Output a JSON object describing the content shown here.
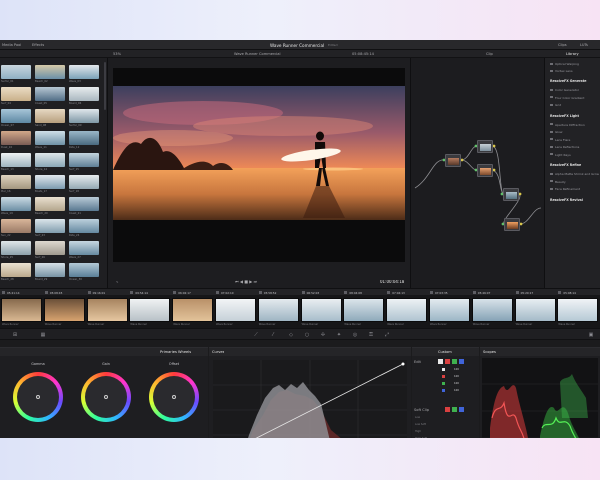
{
  "app": {
    "project_title": "Wave Runner Commercial",
    "project_status": "Edited",
    "timeline_name": "Wave Runner Commercial",
    "zoom": "53%"
  },
  "topbar": {
    "media_pool": "Media Pool",
    "effects": "Effects",
    "clips": "Clips",
    "library": "Library",
    "lut": "LUTs"
  },
  "viewer": {
    "timecode_top": "05:08:45:14",
    "clip_menu": "Clip",
    "timecode": "01:00:04:18",
    "sub_label": "Wave Runner Commercial"
  },
  "pool_thumbs": [
    {
      "label": "Surfer_01",
      "colors": [
        "#8fb0c4",
        "#c9d6de"
      ]
    },
    {
      "label": "Beach_02",
      "colors": [
        "#6a8fa8",
        "#d5c9a8"
      ]
    },
    {
      "label": "Wave_03",
      "colors": [
        "#7aa2b8",
        "#e3e8ec"
      ]
    },
    {
      "label": "Surf_04",
      "colors": [
        "#c9b08a",
        "#eadcc5"
      ]
    },
    {
      "label": "Coast_05",
      "colors": [
        "#506d86",
        "#b7c7d3"
      ]
    },
    {
      "label": "Board_06",
      "colors": [
        "#a9b7bf",
        "#e8ecee"
      ]
    },
    {
      "label": "Ocean_07",
      "colors": [
        "#5d88a3",
        "#a8c6d8"
      ]
    },
    {
      "label": "Sand_08",
      "colors": [
        "#b79f7e",
        "#e6d9c3"
      ]
    },
    {
      "label": "Surfer_09",
      "colors": [
        "#7d97a6",
        "#dfe7ec"
      ]
    },
    {
      "label": "Dusk_10",
      "colors": [
        "#7b5c55",
        "#d1a889"
      ]
    },
    {
      "label": "Wave_11",
      "colors": [
        "#6f91a6",
        "#cfdfe7"
      ]
    },
    {
      "label": "Ride_12",
      "colors": [
        "#4a6a80",
        "#9ab7c8"
      ]
    },
    {
      "label": "Beach_13",
      "colors": [
        "#9fb4bf",
        "#eef2f3"
      ]
    },
    {
      "label": "Shore_14",
      "colors": [
        "#8aa7b6",
        "#dfe6e9"
      ]
    },
    {
      "label": "Surf_15",
      "colors": [
        "#5e7f96",
        "#c3d4de"
      ]
    },
    {
      "label": "Pier_16",
      "colors": [
        "#a49780",
        "#ded3bf"
      ]
    },
    {
      "label": "Boats_17",
      "colors": [
        "#7c9bb0",
        "#e2e9ee"
      ]
    },
    {
      "label": "Surf_18",
      "colors": [
        "#94a9b4",
        "#e8edef"
      ]
    },
    {
      "label": "Wave_19",
      "colors": [
        "#6b8ea4",
        "#cbdbe4"
      ]
    },
    {
      "label": "Beach_20",
      "colors": [
        "#b3a58c",
        "#e9e0d0"
      ]
    },
    {
      "label": "Coast_21",
      "colors": [
        "#597891",
        "#b9cbd7"
      ]
    },
    {
      "label": "Sun_22",
      "colors": [
        "#9a7a66",
        "#d9b69a"
      ]
    },
    {
      "label": "Surf_23",
      "colors": [
        "#7f9cad",
        "#dbe5ea"
      ]
    },
    {
      "label": "Ride_24",
      "colors": [
        "#6488a0",
        "#bcd0dc"
      ]
    },
    {
      "label": "Shore_25",
      "colors": [
        "#8ea2ac",
        "#e0e6e9"
      ]
    },
    {
      "label": "Surf_26",
      "colors": [
        "#a09a8f",
        "#ddd8cf"
      ]
    },
    {
      "label": "Wave_27",
      "colors": [
        "#678aa1",
        "#c6d7e1"
      ]
    },
    {
      "label": "Beach_28",
      "colors": [
        "#bba98d",
        "#ebe2d2"
      ]
    },
    {
      "label": "Board_29",
      "colors": [
        "#7893a4",
        "#d6e1e7"
      ]
    },
    {
      "label": "Ocean_30",
      "colors": [
        "#5a7f98",
        "#b3c9d6"
      ]
    }
  ],
  "library": {
    "items_top": [
      "Optical Warping",
      "Vortex Lens"
    ],
    "group1": {
      "title": "ResolveFX Generate",
      "items": [
        "Color Generator",
        "Four Color Gradient",
        "Grid"
      ]
    },
    "group2": {
      "title": "ResolveFX Light",
      "items": [
        "Aperture Diffraction",
        "Glow",
        "Lens Flare",
        "Lens Reflections",
        "Light Rays"
      ]
    },
    "group3": {
      "title": "ResolveFX Refine",
      "items": [
        "Alpha Matte Shrink and Grow",
        "Beauty",
        "Face Refinement"
      ]
    },
    "group4": {
      "title": "ResolveFX Revival"
    }
  },
  "timeline": {
    "timecodes": [
      "05:21:14",
      "05:08:45",
      "09:16:01",
      "09:54:14",
      "06:02:17",
      "07:02:10",
      "05:58:52",
      "06:52:03",
      "08:04:08",
      "07:04:13",
      "07:03:35",
      "05:46:07",
      "05:20:17",
      "05:08:14"
    ],
    "clips": [
      {
        "label": "Wave Runner",
        "colors": [
          "#d9b892",
          "#876a4d"
        ]
      },
      {
        "label": "Wave Runner",
        "colors": [
          "#d7a36f",
          "#6b5039"
        ]
      },
      {
        "label": "Wave Runner",
        "colors": [
          "#e6c7a0",
          "#a78460"
        ]
      },
      {
        "label": "Wave Runner",
        "colors": [
          "#b8c1c7",
          "#f0f2f3"
        ]
      },
      {
        "label": "Wave Runner",
        "colors": [
          "#e3c39a",
          "#b99169"
        ]
      },
      {
        "label": "Wave Runner",
        "colors": [
          "#c6d1d8",
          "#f2f4f6"
        ]
      },
      {
        "label": "Wave Runner",
        "colors": [
          "#9fb5c3",
          "#e4eaee"
        ]
      },
      {
        "label": "Wave Runner",
        "colors": [
          "#a7bdcb",
          "#e9eef1"
        ]
      },
      {
        "label": "Wave Runner",
        "colors": [
          "#8faabb",
          "#dbe4ea"
        ]
      },
      {
        "label": "Wave Runner",
        "colors": [
          "#b0c4d1",
          "#edf1f4"
        ]
      },
      {
        "label": "Wave Runner",
        "colors": [
          "#9cb6c6",
          "#e3eaef"
        ]
      },
      {
        "label": "Wave Runner",
        "colors": [
          "#86a3b6",
          "#d8e2e9"
        ]
      },
      {
        "label": "Wave Runner",
        "colors": [
          "#a4bac8",
          "#e8eef2"
        ]
      },
      {
        "label": "Wave Runner",
        "colors": [
          "#b6c9d5",
          "#f0f3f6"
        ]
      }
    ]
  },
  "primaries": {
    "title": "Primaries Wheels",
    "wheels": [
      {
        "name": "Gamma",
        "vals": [
          "0.00",
          "0.00",
          "0.00",
          "0.00"
        ]
      },
      {
        "name": "Gain",
        "vals": [
          "1.00",
          "1.00",
          "1.00",
          "1.00"
        ]
      },
      {
        "name": "Offset",
        "vals": [
          "25.00",
          "25.00",
          "25.00",
          "25.00"
        ]
      }
    ],
    "channels": [
      "Y",
      "R",
      "G",
      "B"
    ],
    "footer": [
      {
        "label": "Contrast",
        "value": "1.000"
      },
      {
        "label": "Pivot",
        "value": "0.435"
      },
      {
        "label": "Sat",
        "value": "50.00"
      },
      {
        "label": "Hue",
        "value": "50.00"
      },
      {
        "label": "Lum Mix",
        "value": "100.00"
      }
    ]
  },
  "curves": {
    "title": "Curves",
    "custom": "Custom",
    "edit": "Edit",
    "edit_vals": [
      "100",
      "100",
      "100",
      "100"
    ],
    "soft_clip": "Soft Clip",
    "soft_rows": [
      "Low",
      "Low Soft",
      "High",
      "High Soft"
    ]
  },
  "scopes": {
    "title": "Scopes"
  },
  "nav": [
    {
      "label": "Media",
      "active": false
    },
    {
      "label": "Cut",
      "active": false
    },
    {
      "label": "Edit",
      "active": false
    },
    {
      "label": "Fusion",
      "active": false
    },
    {
      "label": "Color",
      "active": true
    },
    {
      "label": "Fairlight",
      "active": false
    },
    {
      "label": "Deliver",
      "active": false
    }
  ]
}
